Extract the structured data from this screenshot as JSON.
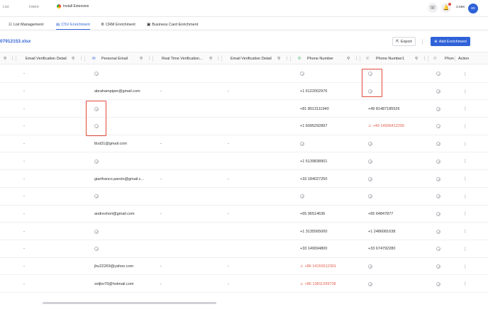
{
  "topbar": {
    "nav_left": "List",
    "nav_intent": "Intent",
    "install_extension": "Install Extension",
    "credits": "3.05K",
    "avatar_initials": "eo"
  },
  "tabs": [
    {
      "label": "List Management",
      "icon": "list-icon",
      "active": false
    },
    {
      "label": "CSV Enrichment",
      "icon": "csv-icon",
      "active": true
    },
    {
      "label": "CRM Enrichment",
      "icon": "crm-icon",
      "active": false
    },
    {
      "label": "Business Card Enrichment",
      "icon": "card-icon",
      "active": false
    }
  ],
  "file": {
    "title": "07912153.xlsx",
    "export_label": "Export",
    "add_enrichment_label": "Add Enrichment"
  },
  "columns": [
    {
      "label": "Email Verification Detail"
    },
    {
      "label": "Personal Email"
    },
    {
      "label": "Real Time Verification..."
    },
    {
      "label": "Email Verification Detail"
    },
    {
      "label": "Phone Number"
    },
    {
      "label": "Phone Number1"
    },
    {
      "label": "Phon"
    },
    {
      "label": "Action"
    }
  ],
  "rows": [
    {
      "evd": "-",
      "personal": "",
      "rtv": "",
      "evd2": "",
      "phone": "",
      "phone1": "",
      "phone1_warn": false
    },
    {
      "evd": "-",
      "personal": "abrahampiper@gmail.com",
      "rtv": "-",
      "evd2": "-",
      "phone": "+1 6122002976",
      "phone1": "",
      "phone1_warn": false
    },
    {
      "evd": "-",
      "personal": "",
      "rtv": "",
      "evd2": "",
      "phone": "+81 8013111940",
      "phone1": "+49 81487185526",
      "phone1_warn": false
    },
    {
      "evd": "-",
      "personal": "",
      "rtv": "",
      "evd2": "",
      "phone": "+1 6095292897",
      "phone1": "+49 14936412200",
      "phone1_warn": true
    },
    {
      "evd": "-",
      "personal": "tbut31@gmail.com",
      "rtv": "-",
      "evd2": "-",
      "phone": "",
      "phone1": "",
      "phone1_warn": false
    },
    {
      "evd": "-",
      "personal": "",
      "rtv": "",
      "evd2": "",
      "phone": "+1 5139838901",
      "phone1": "",
      "phone1_warn": false
    },
    {
      "evd": "-",
      "personal": "gianfranco.parolo@gmail.c...",
      "rtv": "-",
      "evd2": "-",
      "phone": "+33 184027250",
      "phone1": "",
      "phone1_warn": false
    },
    {
      "evd": "-",
      "personal": "",
      "rtv": "",
      "evd2": "",
      "phone": "",
      "phone1": "",
      "phone1_warn": false
    },
    {
      "evd": "-",
      "personal": "andreshori@gmail.com",
      "rtv": "-",
      "evd2": "-",
      "phone": "+65 96514636",
      "phone1": "+65 64847877",
      "phone1_warn": false
    },
    {
      "evd": "-",
      "personal": "",
      "rtv": "",
      "evd2": "",
      "phone": "+1 3135565000",
      "phone1": "+1 2486081638",
      "phone1_warn": false
    },
    {
      "evd": "-",
      "personal": "",
      "rtv": "",
      "evd2": "",
      "phone": "+33 140694800",
      "phone1": "+33 674792280",
      "phone1_warn": false
    },
    {
      "evd": "-",
      "personal": "jhu22269@yahoo.com",
      "rtv": "-",
      "evd2": "-",
      "phone": "+86 14155512301",
      "phone_warn": true,
      "phone1": "",
      "phone1_warn": false
    },
    {
      "evd": "-",
      "personal": "zeljko70@hotmail.com",
      "rtv": "-",
      "evd2": "-",
      "phone": "+86 13811299728",
      "phone_warn": true,
      "phone1": "",
      "phone1_warn": false
    }
  ],
  "colors": {
    "accent": "#2f62d8",
    "highlight": "#e04a3a",
    "warning_text": "#e25c4b"
  }
}
